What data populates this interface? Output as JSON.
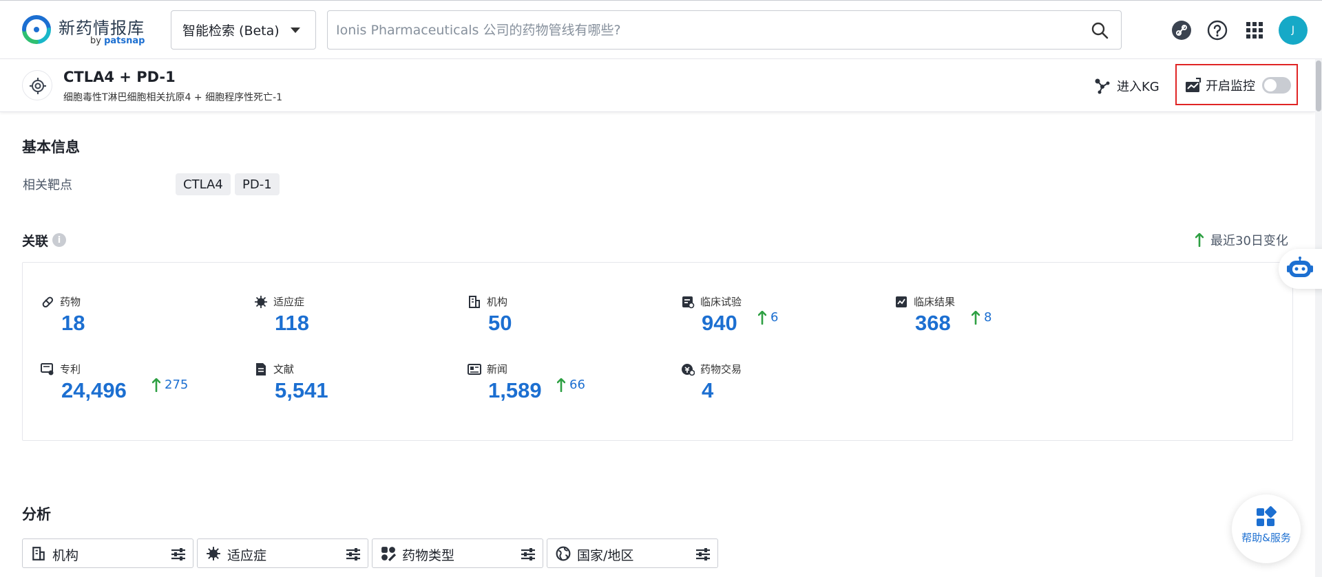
{
  "header": {
    "logo_title": "新药情报库",
    "logo_by": "by",
    "logo_brand": "patsnap",
    "search_mode": "智能检索 (Beta)",
    "search_placeholder": "Ionis Pharmaceuticals 公司的药物管线有哪些?",
    "avatar_initial": "J"
  },
  "entity": {
    "title": "CTLA4 + PD-1",
    "subtitle": "细胞毒性T淋巴细胞相关抗原4 + 细胞程序性死亡-1",
    "kg_label": "进入KG",
    "monitor_label": "开启监控",
    "monitor_on": false
  },
  "basic_info": {
    "title": "基本信息",
    "targets_label": "相关靶点",
    "targets": [
      "CTLA4",
      "PD-1"
    ]
  },
  "relations": {
    "title": "关联",
    "info_glyph": "i",
    "recent_label": "最近30日变化",
    "stats": [
      {
        "label": "药物",
        "value": "18",
        "delta": "",
        "icon": "pill-icon"
      },
      {
        "label": "适应症",
        "value": "118",
        "delta": "",
        "icon": "virus-icon"
      },
      {
        "label": "机构",
        "value": "50",
        "delta": "",
        "icon": "building-icon"
      },
      {
        "label": "临床试验",
        "value": "940",
        "delta": "6",
        "icon": "clinical-trial-icon"
      },
      {
        "label": "临床结果",
        "value": "368",
        "delta": "8",
        "icon": "clinical-result-icon"
      },
      {
        "label": "专利",
        "value": "24,496",
        "delta": "275",
        "icon": "patent-icon"
      },
      {
        "label": "文献",
        "value": "5,541",
        "delta": "",
        "icon": "document-icon"
      },
      {
        "label": "新闻",
        "value": "1,589",
        "delta": "66",
        "icon": "news-icon"
      },
      {
        "label": "药物交易",
        "value": "4",
        "delta": "",
        "icon": "deal-icon"
      }
    ]
  },
  "analysis": {
    "title": "分析",
    "filters": [
      {
        "label": "机构",
        "icon": "building-icon"
      },
      {
        "label": "适应症",
        "icon": "virus-icon"
      },
      {
        "label": "药物类型",
        "icon": "drug-type-icon"
      },
      {
        "label": "国家/地区",
        "icon": "globe-icon"
      }
    ]
  },
  "floating": {
    "help_label": "帮助&服务"
  },
  "colors": {
    "accent": "#1c6fd1",
    "increase_arrow": "#2ea043",
    "highlight_border": "#e02424"
  }
}
